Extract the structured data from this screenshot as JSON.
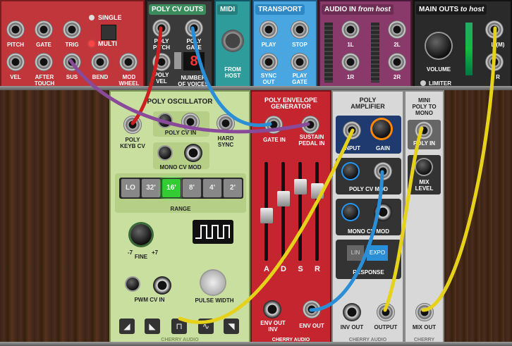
{
  "top_left": {
    "pitch": "PITCH",
    "gate": "GATE",
    "trig": "TRIG",
    "vel": "VEL",
    "aftertouch": "AFTER\nTOUCH",
    "sus": "SUS",
    "bend": "BEND",
    "mod": "MOD\nWHEEL",
    "single": "SINGLE",
    "multi": "MULTI"
  },
  "poly_cv_outs": {
    "title": "POLY CV OUTS",
    "poly_pitch": "POLY\nPITCH",
    "poly_gate": "POLY\nGATE",
    "poly_vel": "POLY\nVEL",
    "num_voices_label": "NUMBER\nOF VOICES",
    "num_voices_value": "8"
  },
  "midi": {
    "title": "MIDI",
    "from_host": "FROM\nHOST"
  },
  "transport": {
    "title": "TRANSPORT",
    "play": "PLAY",
    "stop": "STOP",
    "sync_out": "SYNC\nOUT",
    "play_gate": "PLAY\nGATE"
  },
  "audio_in": {
    "title": "AUDIO IN",
    "subtitle": "from host",
    "l1": "1L",
    "l2": "2L",
    "r1": "1R",
    "r2": "2R"
  },
  "main_outs": {
    "title": "MAIN OUTS",
    "subtitle": "to host",
    "volume": "VOLUME",
    "l_mono": "L (M)",
    "r": "R",
    "limiter": "LIMITER"
  },
  "poly_osc": {
    "title": "POLY OSCILLATOR",
    "keyb_cv": "POLY\nKEYB CV",
    "cv_label": "POLY CV IN",
    "hard_sync": "HARD\nSYNC",
    "mono_cv_mod": "MONO CV MOD",
    "range_buttons": [
      "LO",
      "32'",
      "16'",
      "8'",
      "4'",
      "2'"
    ],
    "range_selected": 2,
    "range": "RANGE",
    "fine": "FINE",
    "minus7": "-7",
    "plus7": "+7",
    "pwm_cv_in": "PWM CV IN",
    "pulse_width": "PULSE WIDTH",
    "brand": "CHERRY AUDIO"
  },
  "poly_env": {
    "title": "POLY ENVELOPE\nGENERATOR",
    "gate_in": "GATE IN",
    "sustain_pedal": "SUSTAIN\nPEDAL IN",
    "sliders": [
      "A",
      "D",
      "S",
      "R"
    ],
    "slider_levels": [
      0.45,
      0.65,
      0.8,
      0.75
    ],
    "env_out_inv": "ENV OUT\nINV",
    "env_out": "ENV OUT",
    "brand": "CHERRY AUDIO"
  },
  "poly_amp": {
    "title": "POLY\nAMPLIFIER",
    "input": "INPUT",
    "gain": "GAIN",
    "poly_cv_mod": "POLY CV MOD",
    "mono_cv_mod": "MONO CV MOD",
    "response": "RESPONSE",
    "expo": "EXPO",
    "lin": "LIN",
    "inv_out": "INV OUT",
    "output": "OUTPUT",
    "brand": "CHERRY AUDIO"
  },
  "mini_poly": {
    "title": "MINI\nPOLY TO\nMONO",
    "poly_in": "POLY IN",
    "mix_level": "MIX\nLEVEL",
    "mix_out": "MIX OUT",
    "brand": "CHERRY"
  },
  "colors": {
    "red_cable": "#cc1f1f",
    "blue_cable": "#2a8fd6",
    "purple_cable": "#8a4a9a",
    "yellow_cable": "#e6d21a"
  }
}
